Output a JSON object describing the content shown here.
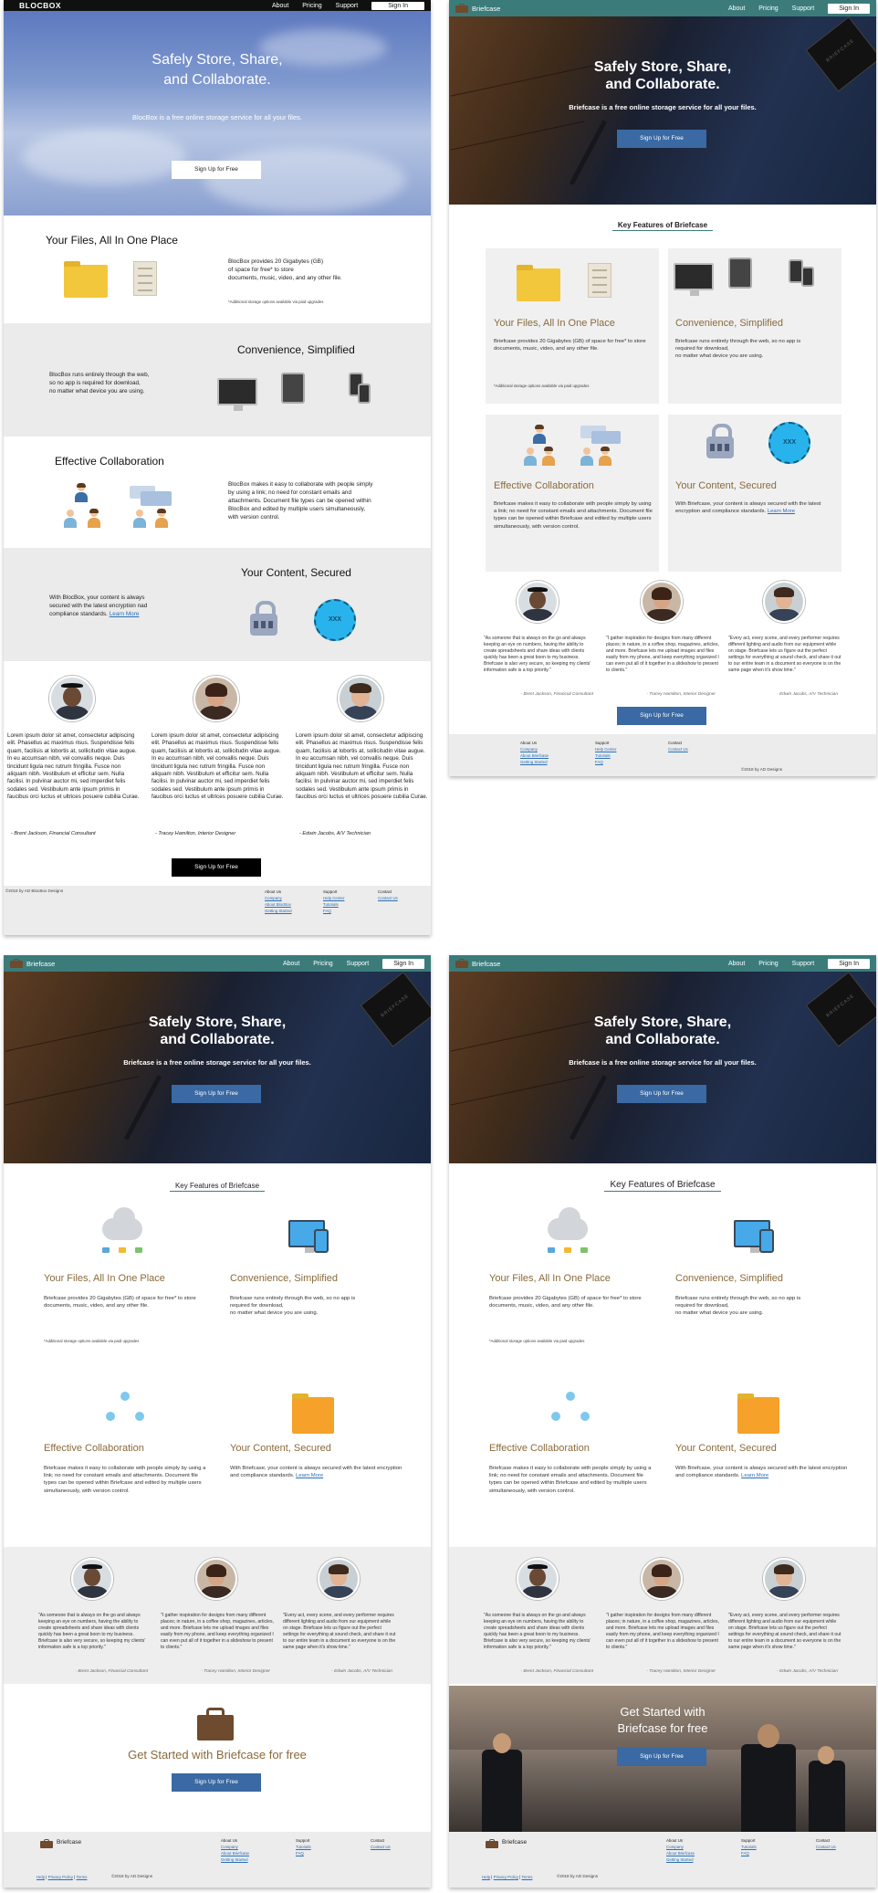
{
  "v1": {
    "nav": {
      "brand": "BLOCBOX",
      "about": "About",
      "pricing": "Pricing",
      "support": "Support",
      "signin": "Sign In"
    },
    "hero": {
      "title1": "Safely Store, Share,",
      "title2": "and Collaborate.",
      "subtitle": "BlocBox is a free online storage service for all your files.",
      "cta": "Sign Up for Free"
    },
    "files": {
      "title": "Your Files, All In One Place",
      "text1": "BlocBox provides 20 Gigabytes (GB)",
      "text2": "of space for free* to store",
      "text3": "documents, music, video, and any other file.",
      "note": "*Additional storage options available via paid upgrades"
    },
    "convenience": {
      "title": "Convenience, Simplified",
      "text1": "BlocBox runs entirely through the web,",
      "text2": "so no app is required for download,",
      "text3": "no matter what device you are using."
    },
    "collab": {
      "title": "Effective Collaboration",
      "text1": "BlocBox makes it easy to collaborate with people simply",
      "text2": "by using a link; no need for constant emails and",
      "text3": "attachments. Document file types can be opened within",
      "text4": "BlocBox and edited by multiple users simultaneously,",
      "text5": "with version control."
    },
    "secured": {
      "title": "Your Content, Secured",
      "text1": "With BlocBox, your content is always",
      "text2": "secured with the latest encryption nad",
      "text3": "compliance standards.",
      "learn": "Learn More",
      "disc": "XXX"
    },
    "lorem": "Lorem ipsum dolor sit amet, consectetur adipiscing elit. Phasellus ac maximus risus. Suspendisse felis quam, facilisis at lobortis at, sollicitudin vitae augue. In eu accumsan nibh, vel convallis neque. Duis tincidunt ligula nec rutrum fringilla. Fusce non aliquam nibh. Vestibulum et efficitur sem. Nulla facilisi. In pulvinar auctor mi, sed imperdiet felis sodales sed. Vestibulum ante ipsum primis in faucibus orci luctus et ultrices posuere cubilia Curae.",
    "sig1": "- Brent Jackson, Financial Consultant",
    "sig2": "- Tracey Hamilton, Interior Designer",
    "sig3": "- Edwin Jacobs, A/V Technician",
    "cta2": "Sign Up for Free",
    "copy": "©2018 by AD BlocBox Designs",
    "footer": {
      "about": "About Us",
      "company": "Company",
      "aboutb": "About BlocBox",
      "getting": "Getting Started",
      "support": "Support",
      "help": "Help Center",
      "tutorials": "Tutorials",
      "faq": "FAQ",
      "contact": "Contact",
      "contactus": "Contact Us"
    }
  },
  "v2": {
    "nav": {
      "brand": "Briefcase",
      "about": "About",
      "pricing": "Pricing",
      "support": "Support",
      "signin": "Sign In"
    },
    "hero": {
      "title1": "Safely Store, Share,",
      "title2": "and Collaborate.",
      "subtitle": "Briefcase is a free online storage service for all your files.",
      "cta": "Sign Up for Free",
      "device": "BRIEFCASE"
    },
    "features_title": "Key Features of Briefcase",
    "files": {
      "title": "Your Files, All In One Place",
      "text": "Briefcase provides 20 Gigabytes (GB) of space for free* to store documents, music, video, and any other file.",
      "note": "*Additional storage options available via paid upgrades"
    },
    "convenience": {
      "title": "Convenience, Simplified",
      "text1": "Briefcase runs entirely through the web, so no app is",
      "text2": "required for download,",
      "text3": "no matter what device you are using."
    },
    "collab": {
      "title": "Effective Collaboration",
      "text": "Briefcase makes it easy to collaborate with people simply by using a link; no need for constant emails and attachments. Document file types can be opened within Briefcase and edited by multiple users simultaneously, with version control."
    },
    "secured": {
      "title": "Your Content, Secured",
      "text": "With Briefcase, your content is always secured with the latest encryption and compliance standards.",
      "learn": "Learn More"
    },
    "quote1": "\"As someone that is always on the go and always keeping an eye on numbers, having the ability to create spreadsheets and share ideas with clients quickly has been a great boon to my business. Briefcase is also very secure, so keeping my clients' information safe is a top priority.\"",
    "quote2": "\"I gather inspiration for designs from many different places; in nature, in a coffee shop, magazines, articles, and more. Briefcase lets me upload images and files easily from my phone, and keep everything organized I can even put all of it together in a slideshow to present to clients.\"",
    "quote3": "\"Every act, every scene, and every performer requires different lighting and audio from our equipment while on stage. Briefcase lets us figure out the perfect settings for everything at sound check, and share it out to our entire team in a document so everyone is on the same page when it's show time.\"",
    "sig1": "- Brent Jackson, Financial Consultant",
    "sig2": "- Tracey Hamilton, Interior Designer",
    "sig3": "- Edwin Jacobs, A/V Technician",
    "cta2": "Sign Up for Free",
    "copy": "©2018 by AD Designs",
    "footer": {
      "about": "About Us",
      "company": "Company",
      "aboutb": "About Briefcase",
      "getting": "Getting Started",
      "support": "Support",
      "help": "Help Center",
      "tutorials": "Tutorials",
      "faq": "FAQ",
      "contact": "Contact",
      "contactus": "Contact Us"
    }
  },
  "v3": {
    "nav": {
      "brand": "Briefcase",
      "about": "About",
      "pricing": "Pricing",
      "support": "Support",
      "signin": "Sign In"
    },
    "hero": {
      "title1": "Safely Store, Share,",
      "title2": "and Collaborate.",
      "subtitle": "Briefcase is a free online storage service for all your files.",
      "cta": "Sign Up for Free",
      "device": "BRIEFCASE"
    },
    "features_title": "Key Features of Briefcase",
    "files": {
      "title": "Your Files, All In One Place",
      "text": "Briefcase provides 20 Gigabytes (GB) of space for free* to store documents, music, video, and any other file.",
      "note": "*Additional storage options available via paid upgrades"
    },
    "convenience": {
      "title": "Convenience, Simplified",
      "text1": "Briefcase runs entirely through the web, so no app is",
      "text2": "required for download,",
      "text3": "no matter what device you are using."
    },
    "collab": {
      "title": "Effective Collaboration",
      "text": "Briefcase makes it easy to collaborate with people simply by using a link; no need for constant emails and attachments. Document file types can be opened within Briefcase and edited by multiple users simultaneously, with version control."
    },
    "secured": {
      "title": "Your Content, Secured",
      "text": "With Briefcase, your content is always secured with the latest encryption and compliance standards.",
      "learn": "Learn More"
    },
    "quote1": "\"As someone that is always on the go and always keeping an eye on numbers, having the ability to create spreadsheets and share ideas with clients quickly has been a great boon to my business. Briefcase is also very secure, so keeping my clients' information safe is a top priority.\"",
    "quote2": "\"I gather inspiration for designs from many different places; in nature, in a coffee shop, magazines, articles, and more. Briefcase lets me upload images and files easily from my phone, and keep everything organized I can even put all of it together in a slideshow to present to clients.\"",
    "quote3": "\"Every act, every scene, and every performer requires different lighting and audio from our equipment while on stage. Briefcase lets us figure out the perfect settings for everything at sound check, and share it out to our entire team in a document so everyone is on the same page when it's show time.\"",
    "sig1": "- Brent Jackson, Financial Consultant",
    "sig2": "- Tracey Hamilton, Interior Designer",
    "sig3": "- Edwin Jacobs, A/V Technician",
    "started": "Get Started with Briefcase for free",
    "started1": "Get Started with",
    "started2": "Briefcase for free",
    "cta2": "Sign Up for Free",
    "footer": {
      "brand": "Briefcase",
      "about": "About Us",
      "company": "Company",
      "aboutb": "About Briefcase",
      "getting": "Getting Started",
      "support": "Support",
      "tutorials": "Tutorials",
      "faq": "FAQ",
      "contact": "Contact",
      "contactus": "Contact Us",
      "help": "Help",
      "privacy": "Privacy Policy",
      "terms": "Terms",
      "sep": "|",
      "copy": "©2018 by AD Designs"
    }
  }
}
